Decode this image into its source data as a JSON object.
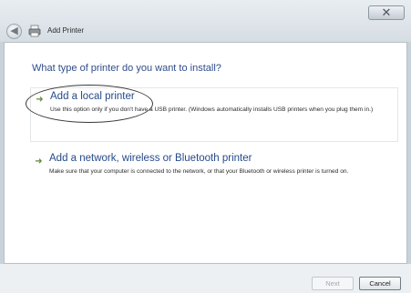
{
  "window": {
    "title": "Add Printer",
    "close_label": "✕"
  },
  "heading": "What type of printer do you want to install?",
  "options": [
    {
      "title": "Add a local printer",
      "description": "Use this option only if you don't have a USB printer. (Windows automatically installs USB printers when you plug them in.)"
    },
    {
      "title": "Add a network, wireless or Bluetooth printer",
      "description": "Make sure that your computer is connected to the network, or that your Bluetooth or wireless printer is turned on."
    }
  ],
  "footer": {
    "next_label": "Next",
    "cancel_label": "Cancel"
  },
  "colors": {
    "heading": "#2f4c8a",
    "option_title": "#264a8a",
    "arrow": "#5f8a3a"
  },
  "icons": [
    "back-arrow-icon",
    "printer-icon",
    "option-arrow-icon"
  ]
}
